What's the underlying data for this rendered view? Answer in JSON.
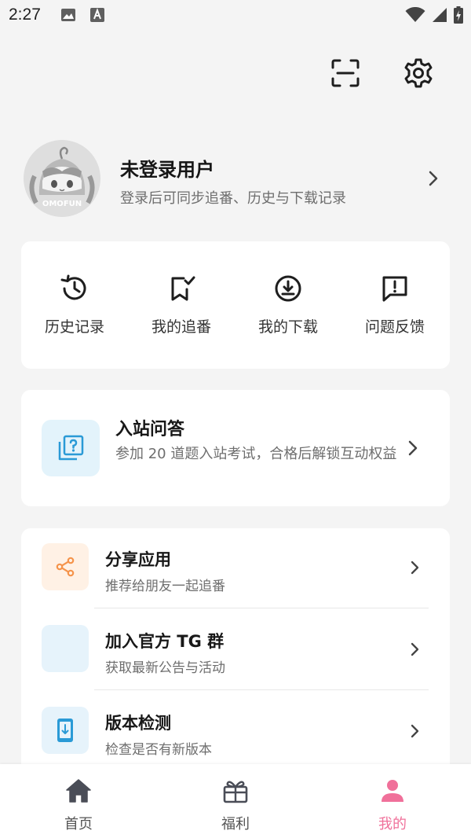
{
  "status_bar": {
    "time": "2:27"
  },
  "profile": {
    "name": "未登录用户",
    "subtitle": "登录后可同步追番、历史与下载记录",
    "avatar_text": "OMOFUN"
  },
  "quick_actions": [
    {
      "label": "历史记录",
      "icon": "history-icon"
    },
    {
      "label": "我的追番",
      "icon": "bookmark-check-icon"
    },
    {
      "label": "我的下载",
      "icon": "download-icon"
    },
    {
      "label": "问题反馈",
      "icon": "feedback-icon"
    }
  ],
  "quiz": {
    "title": "入站问答",
    "description": "参加 20 道题入站考试，合格后解锁互动权益",
    "icon": "question-icon"
  },
  "list": [
    {
      "title": "分享应用",
      "subtitle": "推荐给朋友一起追番",
      "icon": "share-icon"
    },
    {
      "title": "加入官方 TG 群",
      "subtitle": "获取最新公告与活动",
      "icon": "telegram-icon"
    },
    {
      "title": "版本检测",
      "subtitle": "检查是否有新版本",
      "icon": "phone-download-icon"
    }
  ],
  "tabbar": [
    {
      "label": "首页",
      "icon": "home-icon"
    },
    {
      "label": "福利",
      "icon": "gift-icon"
    },
    {
      "label": "我的",
      "icon": "person-icon"
    }
  ],
  "colors": {
    "accent_pink": "#f0709a",
    "background": "#f4f4f4",
    "share_orange": "#f5934a",
    "blue": "#2a9ad6"
  }
}
